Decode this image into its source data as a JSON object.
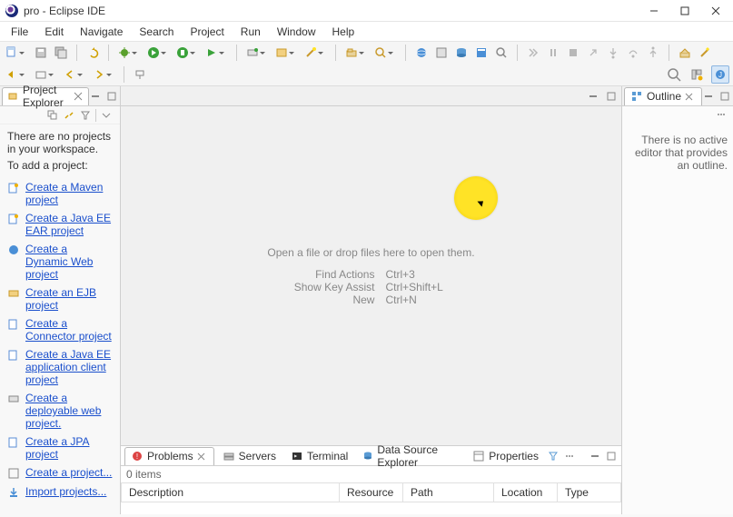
{
  "titlebar": {
    "title": "pro - Eclipse IDE"
  },
  "menu": {
    "items": [
      "File",
      "Edit",
      "Navigate",
      "Search",
      "Project",
      "Run",
      "Window",
      "Help"
    ]
  },
  "projectExplorer": {
    "title": "Project Explorer",
    "empty_msg_1": "There are no projects in your workspace.",
    "empty_msg_2": "To add a project:",
    "links": [
      "Create a Maven project",
      "Create a Java EE EAR project",
      "Create a Dynamic Web project",
      "Create an EJB project",
      "Create a Connector project",
      "Create a Java EE application client project",
      "Create a deployable web project.",
      "Create a JPA project",
      "Create a project...",
      "Import projects..."
    ]
  },
  "editor": {
    "drop_hint": "Open a file or drop files here to open them.",
    "hints": [
      {
        "label": "Find Actions",
        "keys": "Ctrl+3"
      },
      {
        "label": "Show Key Assist",
        "keys": "Ctrl+Shift+L"
      },
      {
        "label": "New",
        "keys": "Ctrl+N"
      }
    ]
  },
  "outline": {
    "title": "Outline",
    "empty": "There is no active editor that provides an outline."
  },
  "bottom": {
    "tabs": [
      "Problems",
      "Servers",
      "Terminal",
      "Data Source Explorer",
      "Properties"
    ],
    "items_label": "0 items",
    "columns": [
      "Description",
      "Resource",
      "Path",
      "Location",
      "Type"
    ]
  }
}
